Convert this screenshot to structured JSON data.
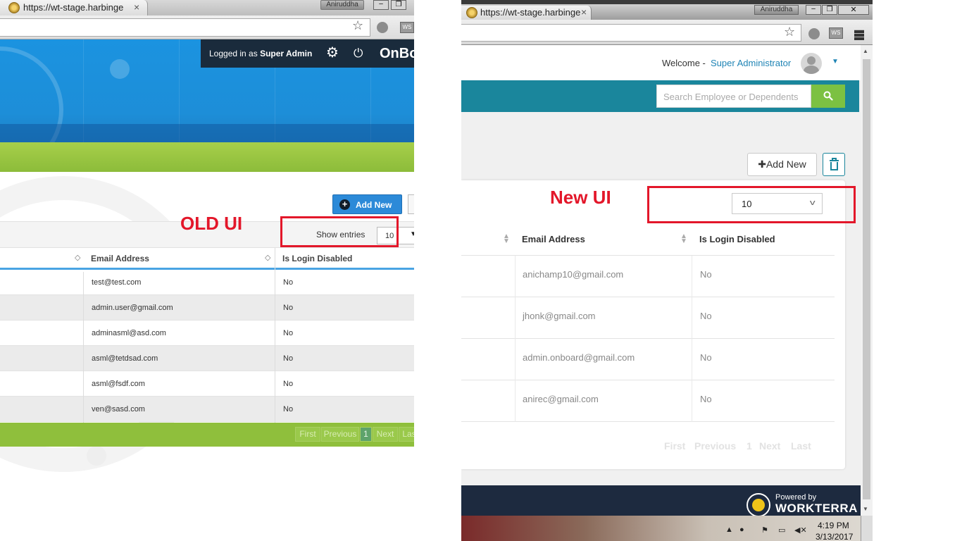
{
  "old_ui": {
    "browser": {
      "tab_title": "https://wt-stage.harbinge",
      "tab_close": "×",
      "user_badge": "Aniruddha",
      "minimize": "–",
      "maximize": "❐",
      "ext_label": "WS"
    },
    "topbar": {
      "logged_in_prefix": "Logged in as ",
      "logged_in_user": "Super Admin",
      "brand": "OnBo"
    },
    "add_new_label": "Add New",
    "show_entries_label": "Show entries",
    "entries_value": "10",
    "annotation_label": "OLD UI",
    "table": {
      "headers": [
        "Email Address",
        "Is Login Disabled"
      ],
      "rows": [
        {
          "email": "test@test.com",
          "disabled": "No"
        },
        {
          "email": "admin.user@gmail.com",
          "disabled": "No"
        },
        {
          "email": "adminasml@asd.com",
          "disabled": "No"
        },
        {
          "email": "asml@tetdsad.com",
          "disabled": "No"
        },
        {
          "email": "asml@fsdf.com",
          "disabled": "No"
        },
        {
          "email": "ven@sasd.com",
          "disabled": "No"
        }
      ]
    },
    "pager": {
      "first": "First",
      "previous": "Previous",
      "current": "1",
      "next": "Next",
      "last": "Las"
    }
  },
  "new_ui": {
    "browser": {
      "tab_title": "https://wt-stage.harbinge",
      "tab_close": "×",
      "user_badge": "Aniruddha",
      "minimize": "–",
      "maximize": "❐",
      "close": "✕",
      "ext_label": "WS"
    },
    "header": {
      "welcome": "Welcome -",
      "username": "Super Administrator"
    },
    "search": {
      "placeholder": "Search Employee or Dependents"
    },
    "add_new_label": "✚Add New",
    "entries_value": "10",
    "annotation_label": "New UI",
    "table": {
      "headers": [
        "Email Address",
        "Is Login Disabled"
      ],
      "rows": [
        {
          "email": "anichamp10@gmail.com",
          "disabled": "No"
        },
        {
          "email": "jhonk@gmail.com",
          "disabled": "No"
        },
        {
          "email": "admin.onboard@gmail.com",
          "disabled": "No"
        },
        {
          "email": "anirec@gmail.com",
          "disabled": "No"
        }
      ]
    },
    "pager": {
      "first": "First",
      "previous": "Previous",
      "current": "1",
      "next": "Next",
      "last": "Last"
    },
    "footer": {
      "powered_by": "Powered by",
      "brand": "WORKTERRA"
    },
    "taskbar": {
      "time": "4:19 PM",
      "date": "3/13/2017"
    }
  },
  "colors": {
    "annotation_red": "#e3172a",
    "old_blue": "#1b93e0",
    "old_green": "#8cbc3a",
    "new_teal": "#1a869c",
    "new_search_green": "#7cc142",
    "footer_navy": "#1d2a3f"
  }
}
